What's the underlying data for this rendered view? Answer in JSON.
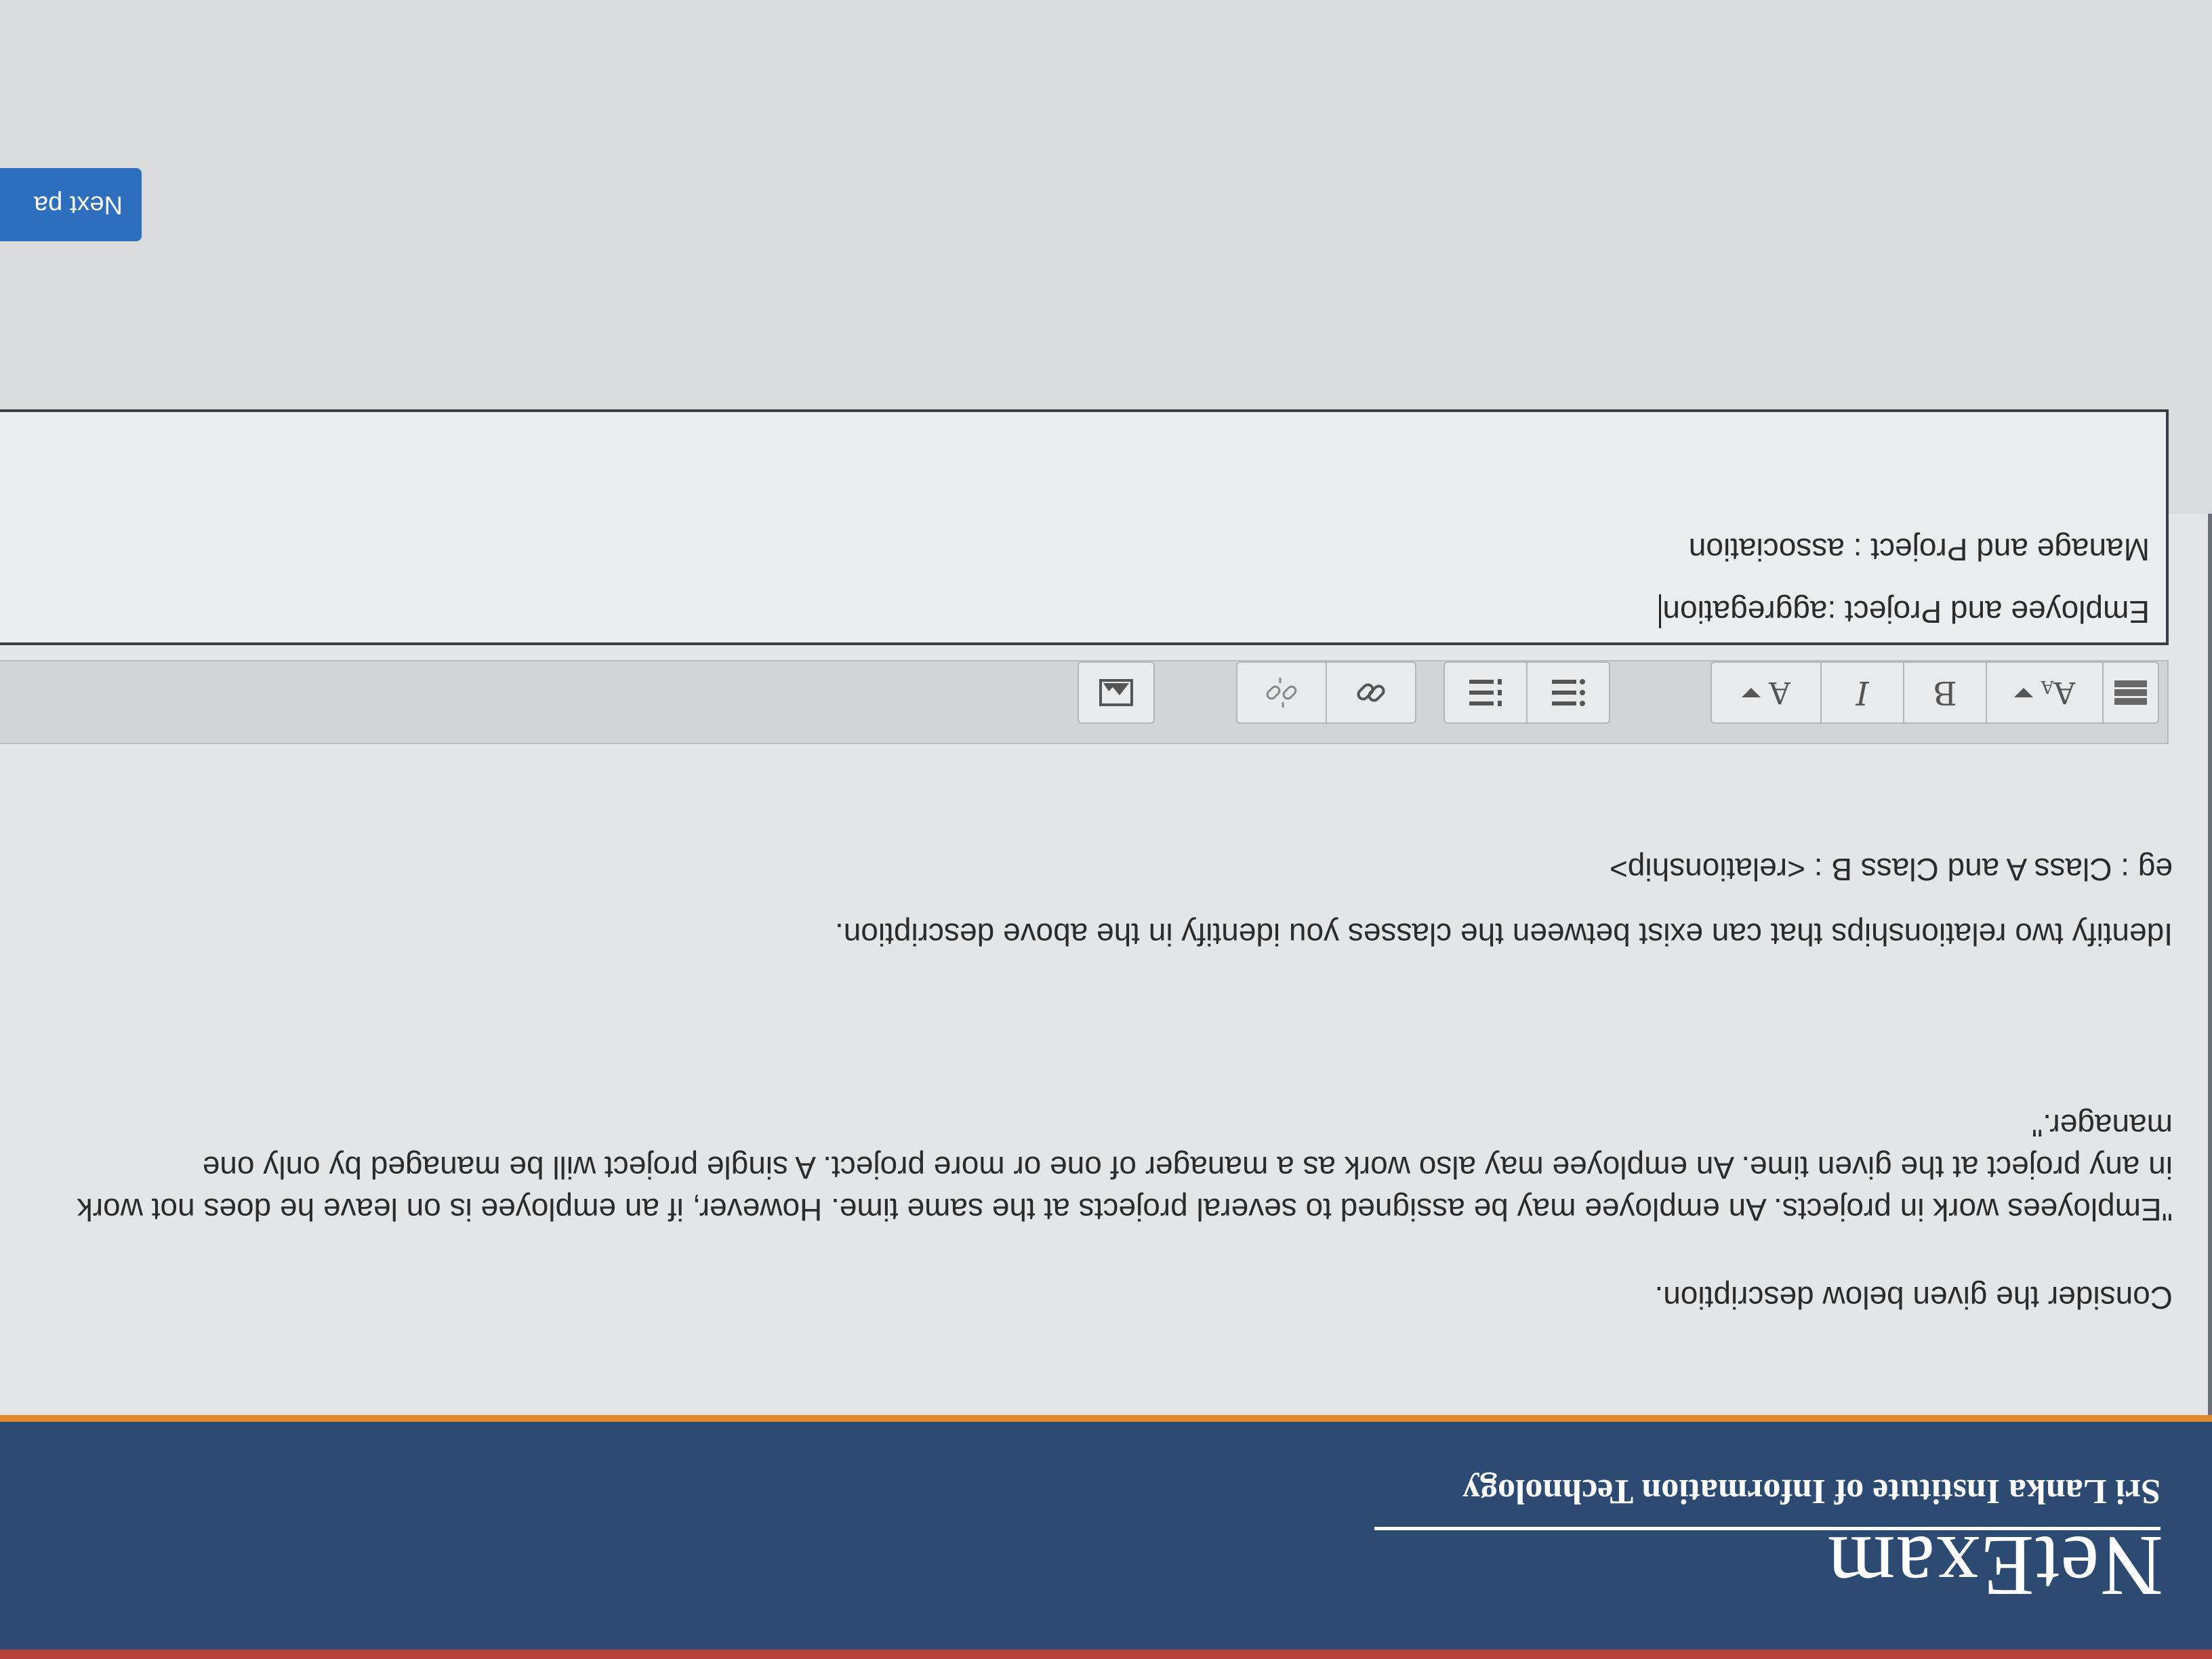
{
  "header": {
    "logo": "NetExam",
    "institute": "Sri Lanka Institute of Information Technology"
  },
  "question": {
    "intro": "Consider the given below description.",
    "description": "\"Employees work in projects. An employee may be assigned to several projects at the same time. However, if an employee is on leave he does not work in any project at the given time. An employee may also work as a manager of one or more project. A single project will be managed by only one manager.\"",
    "prompt": "Identify two relationships that can exist between the classes you identify in the above description.",
    "example": "eg : Class A and Class B : <relationship>"
  },
  "toolbar": {
    "paragraph_style": "A",
    "bold": "B",
    "italic": "I",
    "font_color": "A",
    "icons": [
      "toggle-toolbar-icon",
      "paragraph-styles-icon",
      "bold-icon",
      "italic-icon",
      "font-color-icon",
      "unordered-list-icon",
      "ordered-list-icon",
      "link-icon",
      "unlink-icon",
      "image-icon"
    ]
  },
  "answer": {
    "line1": "Employee and Project :aggregation",
    "line2": "Manage and Project : association"
  },
  "navigation": {
    "next_label": "Next pa"
  },
  "colors": {
    "header_bg": "#2d4a73",
    "orange_line": "#e08a2e",
    "next_button": "#2d6fbe"
  }
}
